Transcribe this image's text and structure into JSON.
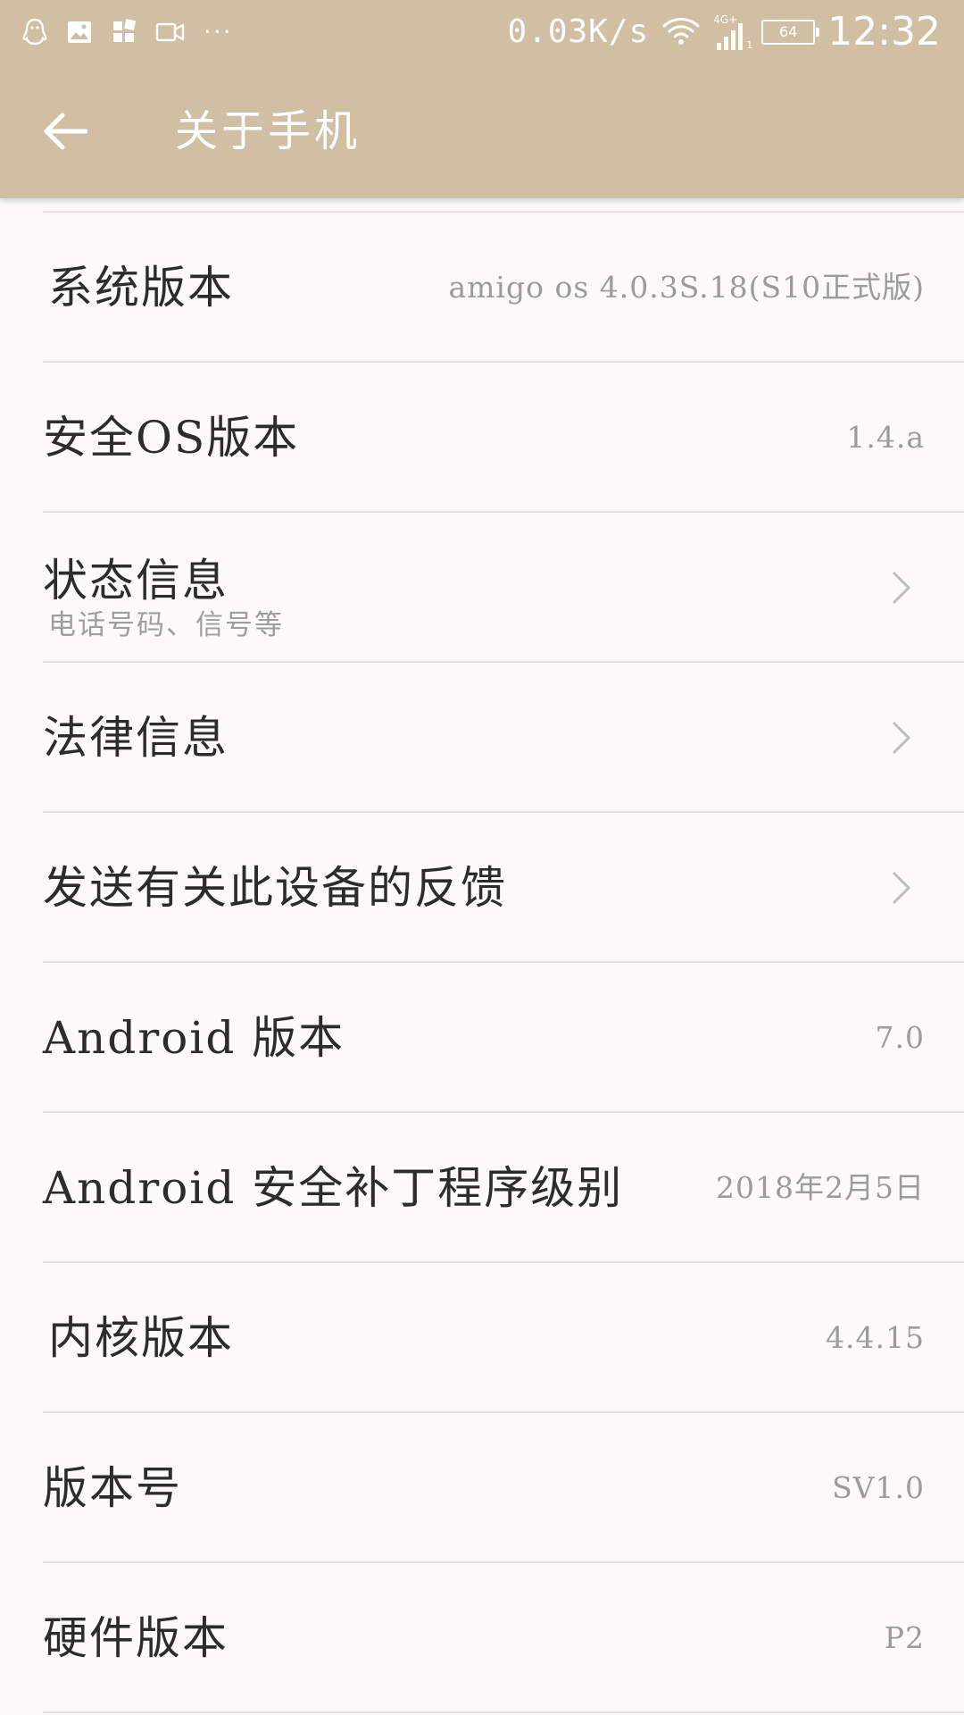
{
  "status_bar": {
    "speed": "0.03K/s",
    "network_type": "4G+",
    "sim_slot": "1",
    "battery": "64",
    "time": "12:32",
    "more": "···",
    "icons": [
      "qq-icon",
      "image-icon",
      "apps-icon",
      "video-icon",
      "wifi-icon",
      "signal-icon",
      "battery-icon"
    ]
  },
  "app_bar": {
    "title": "关于手机",
    "back_icon": "arrow-left-icon"
  },
  "rows": [
    {
      "title": "系统版本",
      "value": "amigo os 4.0.3S.18(S10正式版)"
    },
    {
      "title": "安全OS版本",
      "value": "1.4.a"
    },
    {
      "title": "状态信息",
      "subtitle": "电话号码、信号等",
      "icon": "chevron-right-icon"
    },
    {
      "title": "法律信息",
      "icon": "chevron-right-icon"
    },
    {
      "title": "发送有关此设备的反馈",
      "icon": "chevron-right-icon"
    },
    {
      "title": "Android 版本",
      "value": "7.0"
    },
    {
      "title": "Android 安全补丁程序级别",
      "value": "2018年2月5日"
    },
    {
      "title": "内核版本",
      "value": "4.4.15"
    },
    {
      "title": "版本号",
      "value": "SV1.0"
    },
    {
      "title": "硬件版本",
      "value": "P2"
    }
  ],
  "colors": {
    "header": "#d1bfa4",
    "background": "#fbfaf8",
    "title_text": "#2c2c2c",
    "value_text": "#9b9b9b",
    "divider": "#e6e3df"
  }
}
